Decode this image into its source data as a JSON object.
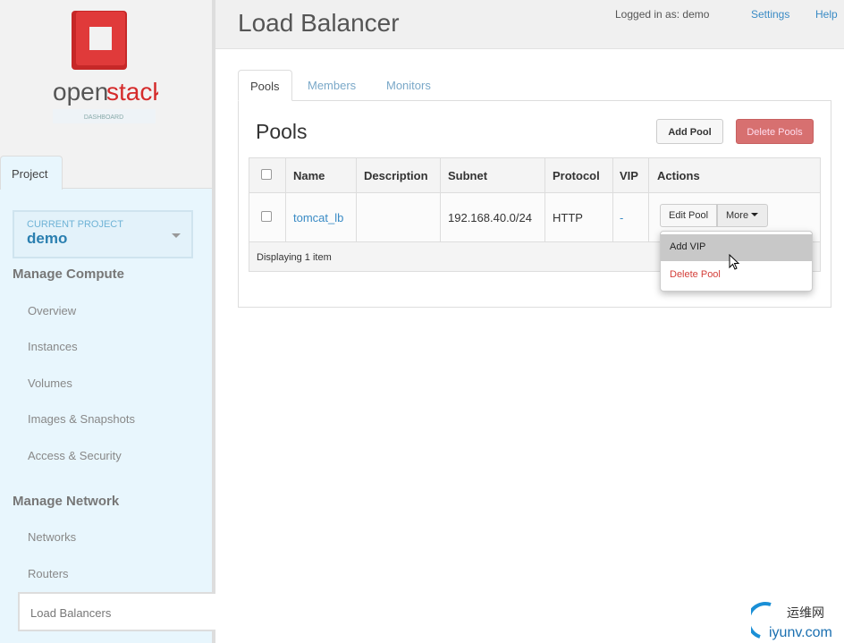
{
  "brand": {
    "name_part1": "open",
    "name_part2": "stack",
    "subtitle": "DASHBOARD"
  },
  "sidebar": {
    "tab": "Project",
    "current_project_label": "CURRENT PROJECT",
    "current_project": "demo",
    "sections": [
      {
        "title": "Manage Compute",
        "items": [
          "Overview",
          "Instances",
          "Volumes",
          "Images & Snapshots",
          "Access & Security"
        ]
      },
      {
        "title": "Manage Network",
        "items": [
          "Networks",
          "Routers",
          "Load Balancers"
        ]
      }
    ],
    "active_item": "Load Balancers"
  },
  "header": {
    "title": "Load Balancer",
    "logged_in": "Logged in as: demo",
    "settings": "Settings",
    "help": "Help"
  },
  "tabs": [
    "Pools",
    "Members",
    "Monitors"
  ],
  "pools": {
    "title": "Pools",
    "add_button": "Add Pool",
    "delete_button": "Delete Pools",
    "columns": [
      "Name",
      "Description",
      "Subnet",
      "Protocol",
      "VIP",
      "Actions"
    ],
    "rows": [
      {
        "name": "tomcat_lb",
        "description": "",
        "subnet": "192.168.40.0/24",
        "protocol": "HTTP",
        "vip": "-",
        "edit": "Edit Pool",
        "more": "More"
      }
    ],
    "footer": "Displaying 1 item",
    "menu": [
      "Add VIP",
      "Delete Pool"
    ]
  },
  "watermark": {
    "cn": "运维网",
    "domain": "iyunv.com"
  },
  "colors": {
    "link": "#3a8bc5",
    "danger": "#d43f3a",
    "brand_red": "#d52b2b"
  }
}
